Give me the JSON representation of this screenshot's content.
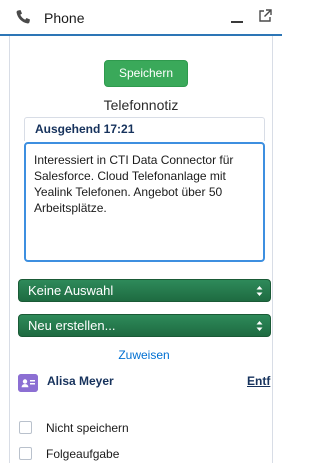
{
  "header": {
    "title": "Phone",
    "icons": [
      "phone-icon",
      "minimize-icon",
      "popout-icon"
    ]
  },
  "toolbar": {
    "save_label": "Speichern"
  },
  "note": {
    "title": "Telefonnotiz",
    "call_label": "Ausgehend 17:21",
    "text": "Interessiert in CTI Data Connector für Salesforce. Cloud Telefonanlage mit Yealink Telefonen. Angebot über 50 Arbeitsplätze."
  },
  "selects": [
    {
      "value": "Keine Auswahl"
    },
    {
      "value": "Neu erstellen..."
    }
  ],
  "assign": {
    "link_label": "Zuweisen"
  },
  "contact": {
    "name": "Alisa Meyer",
    "remove_label": "Entf",
    "icon": "contact-card-icon"
  },
  "checkboxes": [
    {
      "label": "Nicht speichern",
      "checked": false
    },
    {
      "label": "Folgeaufgabe",
      "checked": false
    }
  ],
  "colors": {
    "accent": "#2d76b6",
    "save_button": "#3aa95a",
    "select_bg": "#2e8a5a",
    "link": "#0070d2",
    "contact_icon": "#8c6fd3"
  }
}
